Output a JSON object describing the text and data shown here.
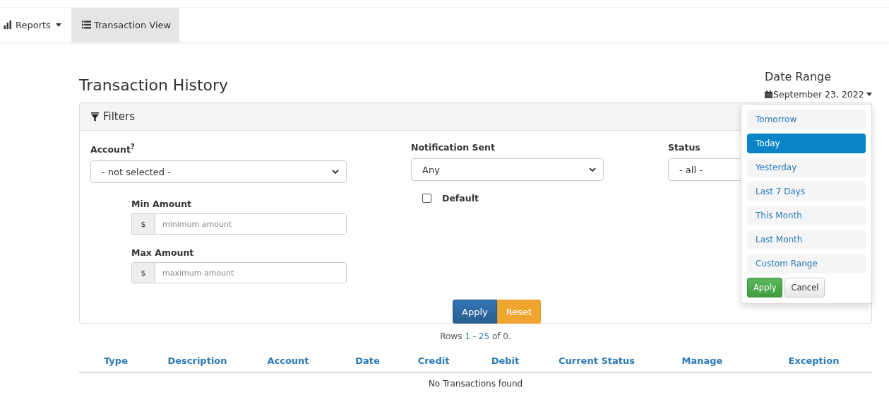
{
  "nav": {
    "items": [
      {
        "label": "Reports",
        "dropdown": true,
        "selected": false
      },
      {
        "label": "Transaction View",
        "dropdown": false,
        "selected": true
      }
    ]
  },
  "page_title": "Transaction History",
  "date_range": {
    "label": "Date Range",
    "value": "September 23, 2022",
    "options": [
      {
        "label": "Tomorrow",
        "selected": false
      },
      {
        "label": "Today",
        "selected": true
      },
      {
        "label": "Yesterday",
        "selected": false
      },
      {
        "label": "Last 7 Days",
        "selected": false
      },
      {
        "label": "This Month",
        "selected": false
      },
      {
        "label": "Last Month",
        "selected": false
      },
      {
        "label": "Custom Range",
        "selected": false
      }
    ],
    "buttons": [
      {
        "label": "Apply",
        "kind": "success"
      },
      {
        "label": "Cancel",
        "kind": "default"
      }
    ]
  },
  "filters": {
    "title": "Filters",
    "account": {
      "label": "Account$^{?}$",
      "value": "- not selected -"
    },
    "min_amount": {
      "label": "Min Amount",
      "prefix": "$",
      "placeholder": "minimum amount"
    },
    "max_amount": {
      "label": "Max Amount",
      "prefix": "$",
      "placeholder": "maximum amount"
    },
    "notification": {
      "label": "Notification Sent",
      "value": "Any"
    },
    "default": {
      "label": "Default",
      "checked": false
    },
    "status": {
      "label": "Status",
      "value": "- all -"
    },
    "buttons": [
      {
        "label": "Apply",
        "kind": "primary"
      },
      {
        "label": "Reset",
        "kind": "warning"
      }
    ]
  },
  "rows_info": {
    "prefix": "Rows",
    "start": "1",
    "separator": "-",
    "end": "25",
    "suffix": "of 0."
  },
  "table": {
    "columns": [
      "Type",
      "Description",
      "Account",
      "Date",
      "Credit",
      "Debit",
      "Current Status",
      "Manage",
      "Exception"
    ],
    "empty_message": "No Transactions found"
  }
}
